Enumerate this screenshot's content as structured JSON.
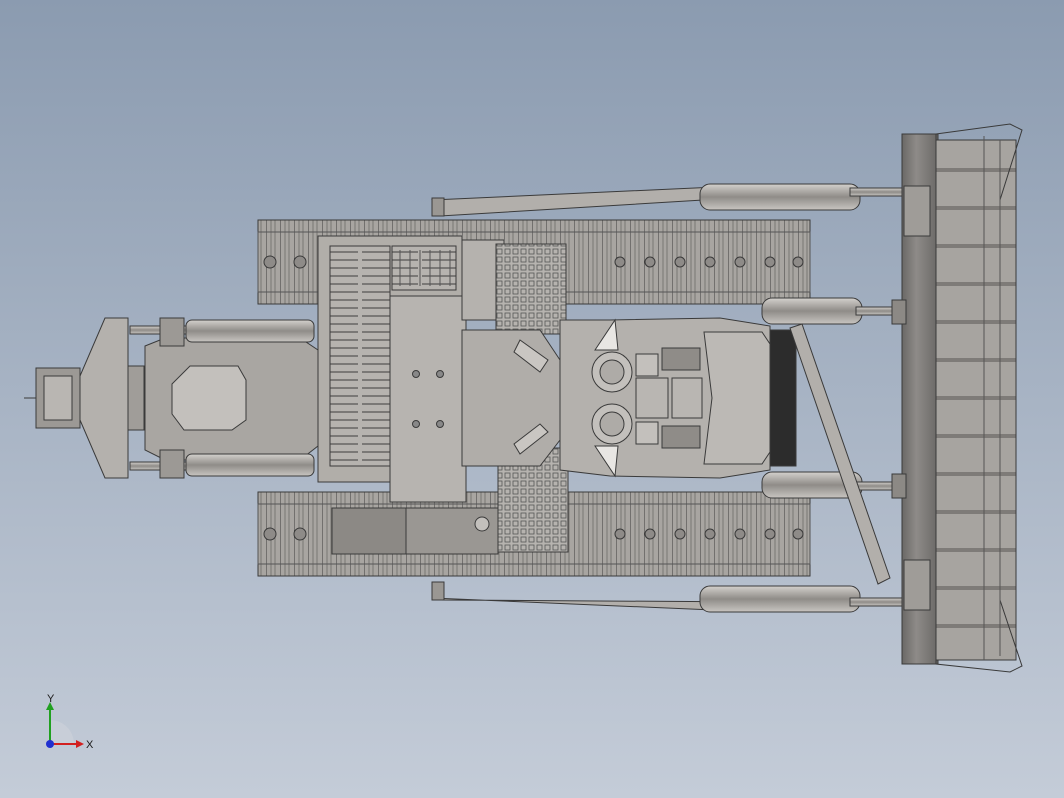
{
  "viewport": {
    "background_top": "#8b9bb0",
    "background_bottom": "#c4ccd8",
    "model_fill": "#a9a6a2",
    "model_stroke": "#3a3a3a",
    "model_dark": "#6f6c69",
    "model_light": "#c3c0bc"
  },
  "triad": {
    "x_label": "X",
    "y_label": "Y",
    "x_color": "#d22020",
    "y_color": "#20a020",
    "z_color": "#2030d0"
  }
}
